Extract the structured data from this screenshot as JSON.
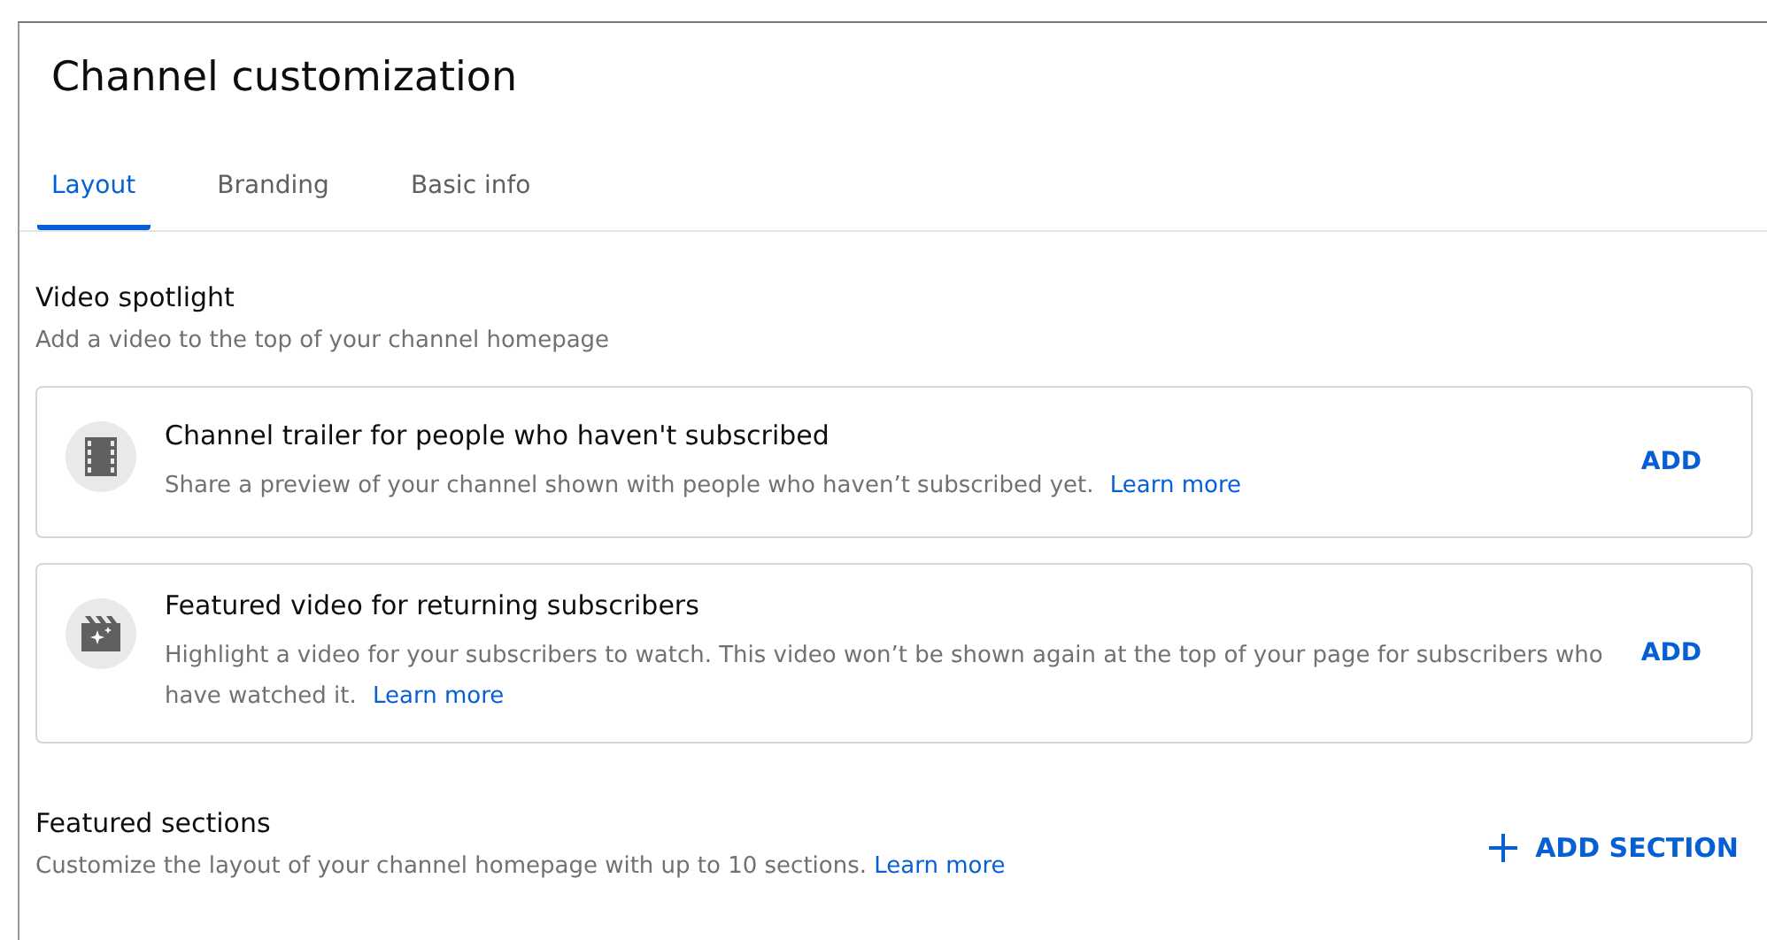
{
  "title": "Channel customization",
  "tabs": [
    {
      "label": "Layout",
      "selected": true
    },
    {
      "label": "Branding",
      "selected": false
    },
    {
      "label": "Basic info",
      "selected": false
    }
  ],
  "video_spotlight": {
    "heading": "Video spotlight",
    "description": "Add a video to the top of your channel homepage",
    "cards": [
      {
        "kind": "trailer",
        "title": "Channel trailer for people who haven't subscribed",
        "description": "Share a preview of your channel shown with people who haven’t subscribed yet.",
        "link": "Learn more",
        "action": "ADD"
      },
      {
        "kind": "featured",
        "title": "Featured video for returning subscribers",
        "description": "Highlight a video for your subscribers to watch. This video won’t be shown again at the top of your page for subscribers who have watched it.",
        "link": "Learn more",
        "action": "ADD"
      }
    ]
  },
  "featured_sections": {
    "heading": "Featured sections",
    "description": "Customize the layout of your channel homepage with up to 10 sections.",
    "link": "Learn more",
    "action": "ADD SECTION"
  }
}
